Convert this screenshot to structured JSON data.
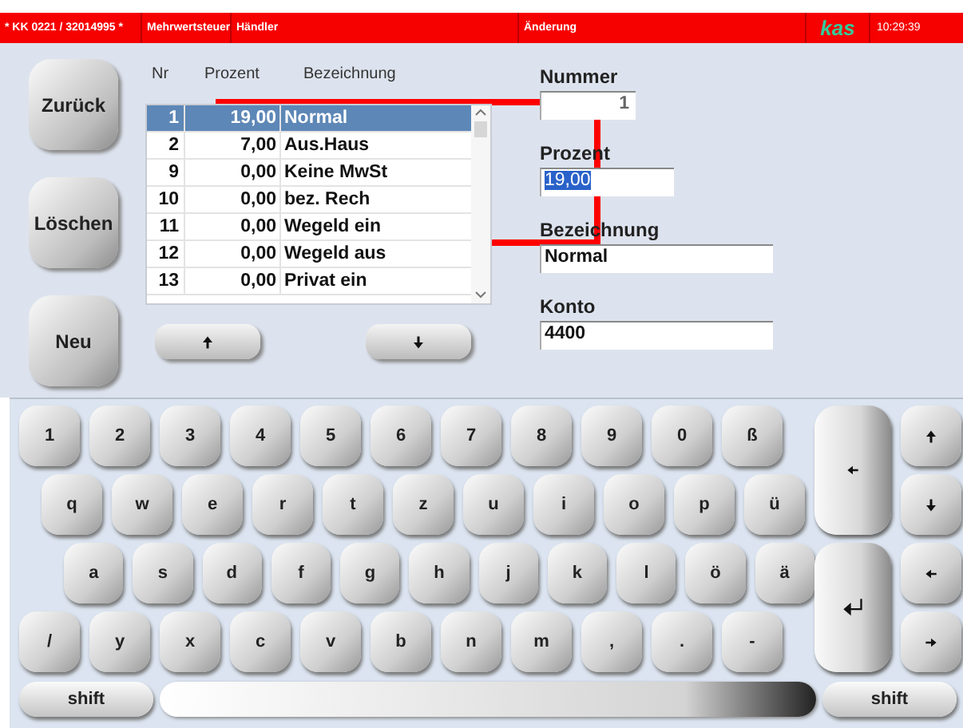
{
  "status_bar": {
    "fields": [
      "* KK 0221 / 32014995 *",
      "Mehrwertsteuer",
      "Händler",
      "Änderung"
    ],
    "logo": "kas",
    "time": "10:29:39"
  },
  "actions": [
    "Zurück",
    "Löschen",
    "Neu"
  ],
  "table": {
    "columns": [
      "Nr",
      "Prozent",
      "Bezeichnung"
    ],
    "rows": [
      {
        "nr": "1",
        "prozent": "19,00",
        "bezeichnung": "Normal",
        "selected": true
      },
      {
        "nr": "2",
        "prozent": "7,00",
        "bezeichnung": "Aus.Haus",
        "selected": false
      },
      {
        "nr": "9",
        "prozent": "0,00",
        "bezeichnung": "Keine MwSt",
        "selected": false
      },
      {
        "nr": "10",
        "prozent": "0,00",
        "bezeichnung": "bez. Rech",
        "selected": false
      },
      {
        "nr": "11",
        "prozent": "0,00",
        "bezeichnung": "Wegeld ein",
        "selected": false
      },
      {
        "nr": "12",
        "prozent": "0,00",
        "bezeichnung": "Wegeld aus",
        "selected": false
      },
      {
        "nr": "13",
        "prozent": "0,00",
        "bezeichnung": "Privat ein",
        "selected": false
      }
    ]
  },
  "form": [
    {
      "label": "Nummer",
      "value": "1",
      "kind": "number"
    },
    {
      "label": "Prozent",
      "value": "19,00",
      "kind": "selected"
    },
    {
      "label": "Bezeichnung",
      "value": "Normal",
      "kind": "wide"
    },
    {
      "label": "Konto",
      "value": "4400",
      "kind": "wide"
    }
  ],
  "keyboard": {
    "rows": [
      [
        "1",
        "2",
        "3",
        "4",
        "5",
        "6",
        "7",
        "8",
        "9",
        "0",
        "ß"
      ],
      [
        "q",
        "w",
        "e",
        "r",
        "t",
        "z",
        "u",
        "i",
        "o",
        "p",
        "ü"
      ],
      [
        "a",
        "s",
        "d",
        "f",
        "g",
        "h",
        "j",
        "k",
        "l",
        "ö",
        "ä"
      ],
      [
        "/",
        "y",
        "x",
        "c",
        "v",
        "b",
        "n",
        "m",
        ",",
        ".",
        "-"
      ]
    ],
    "shift": [
      "shift",
      "shift"
    ]
  }
}
